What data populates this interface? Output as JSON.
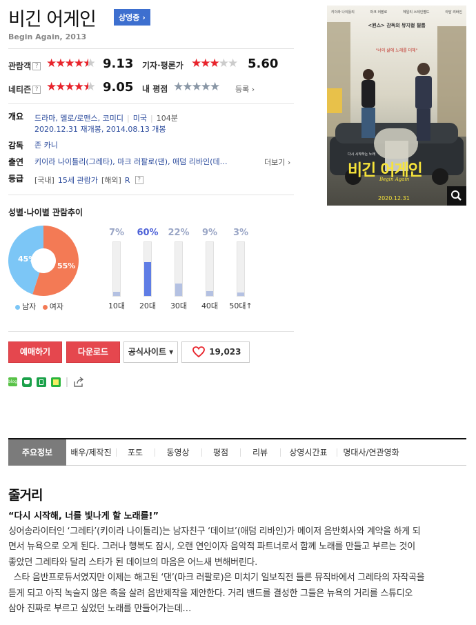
{
  "movie": {
    "title": "비긴 어게인",
    "status_badge": "상영중 ›",
    "original_title": "Begin Again, 2013"
  },
  "ratings": {
    "audience": {
      "label": "관람객",
      "score": "9.13",
      "stars": 4.5
    },
    "critic": {
      "label": "기자·평론가",
      "score": "5.60",
      "stars": 3
    },
    "netizen": {
      "label": "네티즌",
      "score": "9.05",
      "stars": 4.5
    },
    "my": {
      "label": "내 평점",
      "action": "등록 ›"
    },
    "help_icon": "?"
  },
  "info": {
    "overview_label": "개요",
    "genres": "드라마, 멜로/로맨스, 코미디",
    "country": "미국",
    "runtime": "104분",
    "release": "2020.12.31 재개봉, 2014.08.13 개봉",
    "director_label": "감독",
    "director": "존 카니",
    "cast_label": "출연",
    "cast": "키이라 나이틀리(그레타), 마크 러팔로(댄), 애덤 리바인(데…",
    "more": "더보기 ›",
    "grade_label": "등급",
    "grade_domestic_prefix": "[국내]",
    "grade_domestic": "15세 관람가",
    "grade_overseas_prefix": "[해외]",
    "grade_overseas": "R"
  },
  "chart_data": {
    "type": "pie",
    "title": "성별·나이별 관람추이",
    "gender": {
      "categories": [
        "남자",
        "여자"
      ],
      "values": [
        45,
        55
      ],
      "labels": [
        "45%",
        "55%"
      ],
      "colors": [
        "#7cc6f6",
        "#f37a55"
      ]
    },
    "age": {
      "type": "bar",
      "categories": [
        "10대",
        "20대",
        "30대",
        "40대",
        "50대↑"
      ],
      "values": [
        7,
        60,
        22,
        9,
        3
      ],
      "labels": [
        "7%",
        "60%",
        "22%",
        "9%",
        "3%"
      ],
      "highlight": "20대",
      "ylim": [
        0,
        100
      ]
    }
  },
  "actions": {
    "reserve": "예매하기",
    "download": "다운로드",
    "official_site": "공식사이트 ▾",
    "likes": "19,023"
  },
  "share_icons": [
    "blog-icon",
    "cafe-icon",
    "bookmark-icon",
    "memo-icon",
    "share-icon"
  ],
  "tabs": [
    "주요정보",
    "배우/제작진",
    "포토",
    "동영상",
    "평점",
    "리뷰",
    "상영시간표",
    "명대사/연관영화"
  ],
  "story": {
    "heading": "줄거리",
    "quote": "“다시 시작해, 너를 빛나게 할 노래를!”",
    "body": "싱어송라이터인 ‘그레타’(키이라 나이틀리)는 남자친구 ‘데이브’(애덤 리바인)가 메이저 음반회사와 계약을 하게 되\n면서 뉴욕으로 오게 된다. 그러나 행복도 잠시, 오랜 연인이자 음악적 파트너로서 함께 노래를 만들고 부르는 것이\n좋았던 그레타와 달리 스타가 된 데이브의 마음은 어느새 변해버린다.\n  스타 음반프로듀서였지만 이제는 해고된 ‘댄’(마크 러팔로)은 미치기 일보직전 들른 뮤직바에서 그레타의 자작곡을\n듣게 되고 아직 녹슬지 않은 촉을 살려 음반제작을 제안한다. 거리 밴드를 결성한 그들은 뉴욕의 거리를 스튜디오\n삼아 진짜로 부르고 싶었던 노래를 만들어가는데…"
  },
  "poster": {
    "credits": [
      "키이라 나이틀리",
      "마크 러팔로",
      "헤일리 스테인펠드",
      "아담 리바인"
    ],
    "director_line": "<원스> 감독의 뮤지컬 필름",
    "tagline": "\"너의 삶에 노래를 더해\"",
    "small_line": "다시 시작하는 노래",
    "title": "비긴 어게인",
    "title_en": "Begin Again",
    "date": "2020.12.31",
    "zoom_icon": "search-icon"
  },
  "colors": {
    "accent_red": "#e5474e",
    "star_red": "#e8242c",
    "link_blue": "#2a4a9c",
    "badge_blue": "#3d6fcf"
  }
}
